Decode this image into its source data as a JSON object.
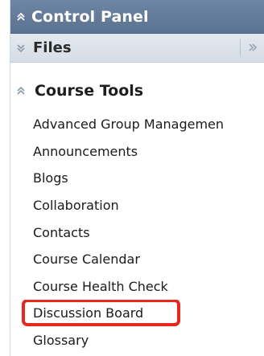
{
  "control_panel": {
    "title": "Control Panel",
    "collapse_icon": "double-chevron-up-icon",
    "header_color": "#6279a0"
  },
  "files": {
    "label": "Files",
    "expand_icon": "double-chevron-down-icon",
    "side_icon": "double-chevron-right-icon"
  },
  "course_tools": {
    "title": "Course Tools",
    "collapse_icon": "double-chevron-up-icon",
    "items": [
      {
        "label": "Advanced Group Managemen"
      },
      {
        "label": "Announcements"
      },
      {
        "label": "Blogs"
      },
      {
        "label": "Collaboration"
      },
      {
        "label": "Contacts"
      },
      {
        "label": "Course Calendar"
      },
      {
        "label": "Course Health Check"
      },
      {
        "label": "Discussion Board"
      },
      {
        "label": "Glossary"
      }
    ]
  },
  "highlight_color": "#e8281e"
}
